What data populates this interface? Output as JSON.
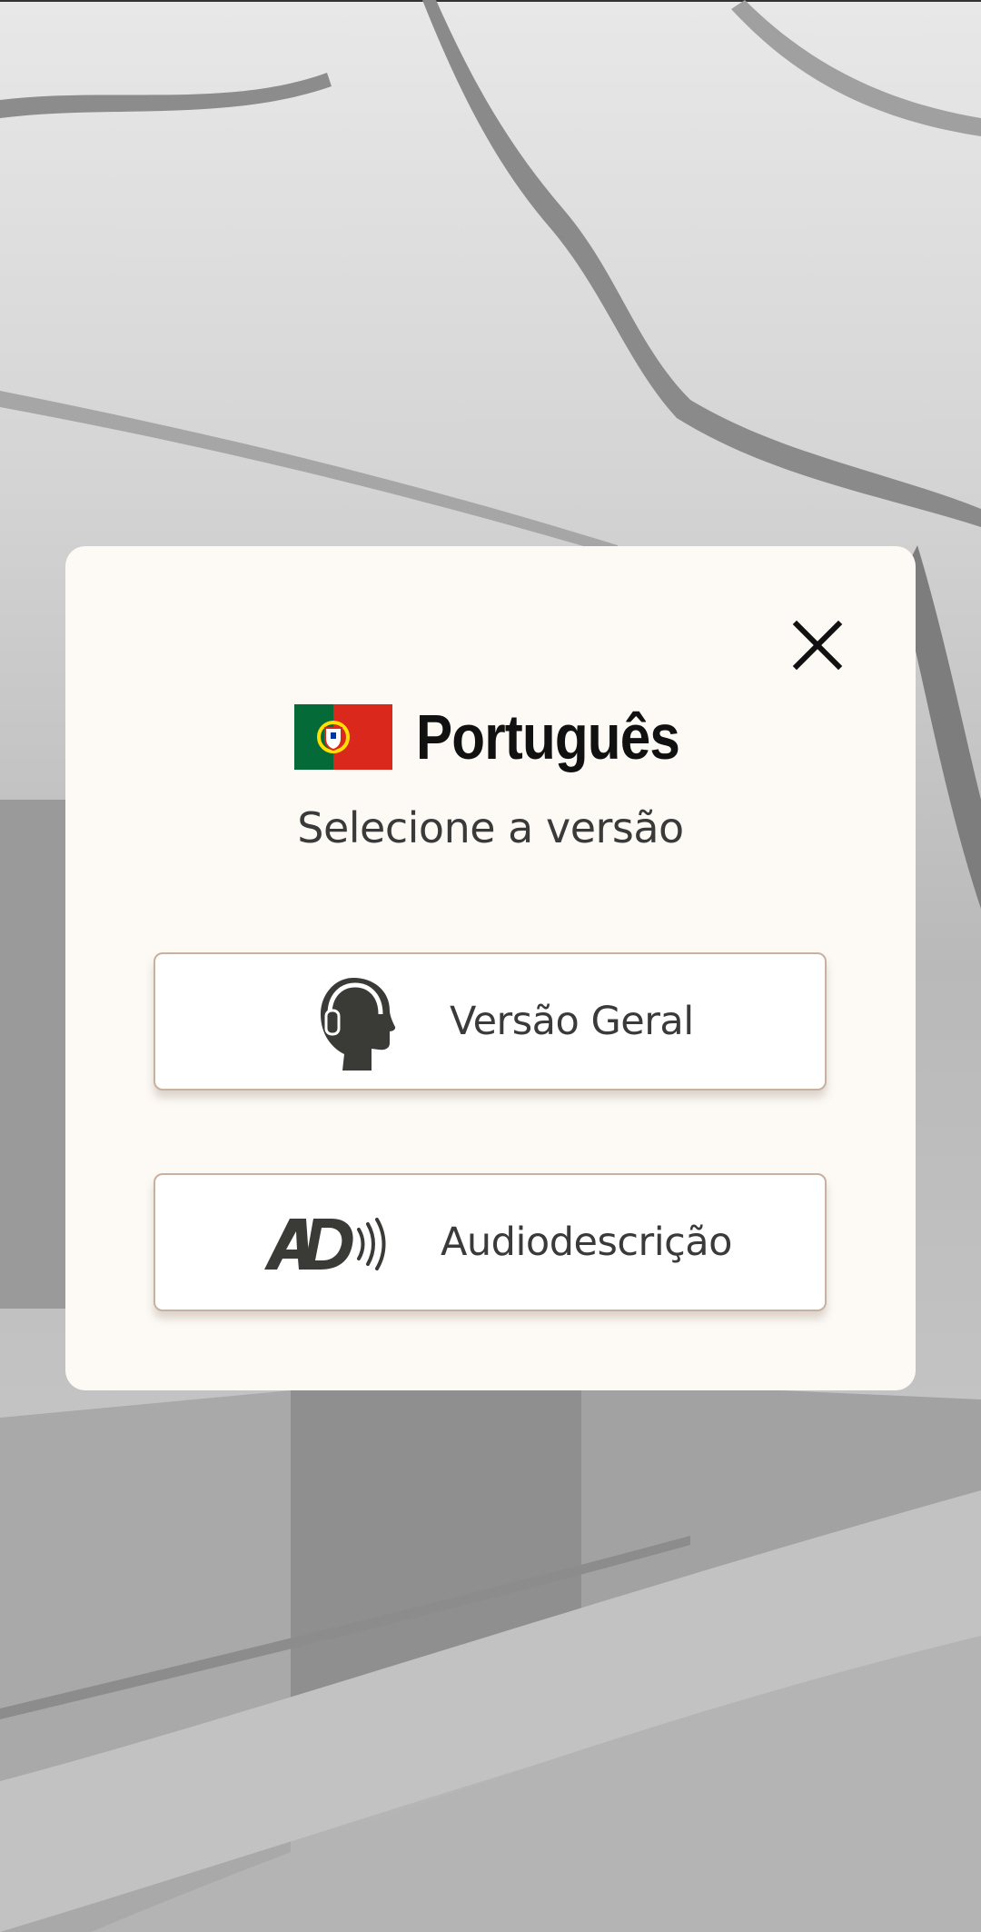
{
  "dialog": {
    "language_name": "Português",
    "flag_icon": "portugal-flag-icon",
    "subtitle": "Selecione a versão",
    "close_icon": "close-icon"
  },
  "options": [
    {
      "label": "Versão Geral",
      "icon": "head-headphones-icon"
    },
    {
      "label": "Audiodescrição",
      "icon": "audio-description-icon"
    }
  ],
  "colors": {
    "modal_background": "#fdfaf6",
    "button_border": "#c8b19f",
    "text": "#3a3a3a",
    "title": "#111111",
    "flag_green": "#046a38",
    "flag_red": "#da291c",
    "flag_yellow": "#ffe000"
  }
}
